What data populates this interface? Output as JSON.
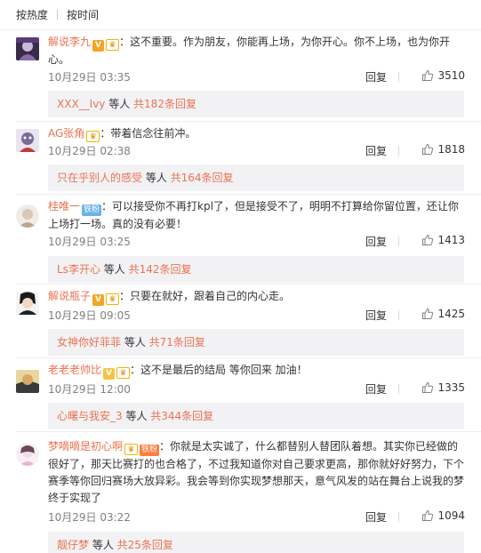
{
  "sort": {
    "hot": "按热度",
    "time": "按时间"
  },
  "comments": [
    {
      "user": "解说李九",
      "text": "：这不重要。作为朋友，你能再上场，为你开心。你不上场，也为你开心。",
      "time": "10月29日 03:35",
      "reply": "回复",
      "likes": "3510",
      "sub_user": "XXX__Ivy",
      "sub_mid": " 等人 ",
      "sub_count": "共182条回复"
    },
    {
      "user": "AG张角",
      "text": "：带着信念往前冲。",
      "time": "10月29日 02:38",
      "reply": "回复",
      "likes": "1818",
      "sub_user": "只在乎别人的感受",
      "sub_mid": " 等人 ",
      "sub_count": "共164条回复"
    },
    {
      "user": "桂唯一",
      "tag": "铁粉",
      "text": "：可以接受你不再打kpl了，但是接受不了，明明不打算给你留位置，还让你上场打一场。真的没有必要！",
      "time": "10月29日 03:25",
      "reply": "回复",
      "likes": "1413",
      "sub_user": "Ls李开心",
      "sub_mid": " 等人 ",
      "sub_count": "共142条回复"
    },
    {
      "user": "解说瓶子",
      "text": "：只要在就好，跟着自己的内心走。",
      "time": "10月29日 09:05",
      "reply": "回复",
      "likes": "1425",
      "sub_user": "女神你好菲菲",
      "sub_mid": " 等人 ",
      "sub_count": "共71条回复"
    },
    {
      "user": "老老老帅比",
      "text": "：这不是最后的结局 等你回来 加油！",
      "time": "10月29日 12:00",
      "reply": "回复",
      "likes": "1335",
      "sub_user": "心曙与我安_3",
      "sub_mid": " 等人 ",
      "sub_count": "共344条回复"
    },
    {
      "user": "梦嘀嘀是初心啊",
      "tag": "铁粉",
      "text": "：你就是太实诚了，什么都替别人替团队着想。其实你已经做的很好了，那天比赛打的也合格了，不过我知道你对自己要求更高，那你就好好努力，下个赛季等你回归赛场大放异彩。我会等到你实现梦想那天，意气风发的站在舞台上说我的梦终于实现了",
      "time": "10月29日 03:22",
      "reply": "回复",
      "likes": "1094",
      "sub_user": "靓仔梦",
      "sub_mid": " 等人 ",
      "sub_count": "共25条回复"
    }
  ]
}
